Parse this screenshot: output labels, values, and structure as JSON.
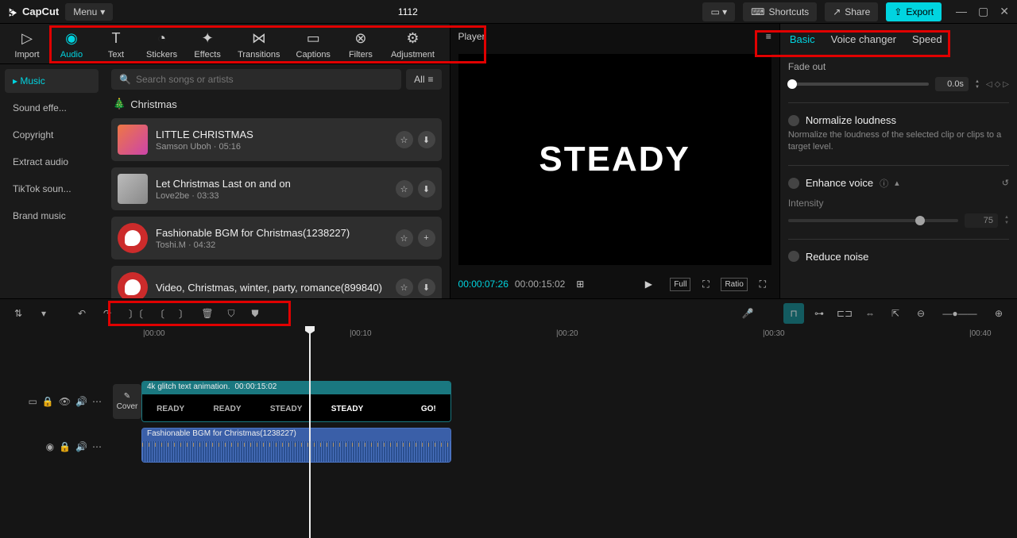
{
  "titlebar": {
    "brand": "CapCut",
    "menu_label": "Menu",
    "project_title": "1112",
    "shortcuts": "Shortcuts",
    "share": "Share",
    "export": "Export"
  },
  "tool_tabs": [
    {
      "id": "import",
      "label": "Import"
    },
    {
      "id": "audio",
      "label": "Audio",
      "active": true
    },
    {
      "id": "text",
      "label": "Text"
    },
    {
      "id": "stickers",
      "label": "Stickers"
    },
    {
      "id": "effects",
      "label": "Effects"
    },
    {
      "id": "transitions",
      "label": "Transitions"
    },
    {
      "id": "captions",
      "label": "Captions"
    },
    {
      "id": "filters",
      "label": "Filters"
    },
    {
      "id": "adjustment",
      "label": "Adjustment"
    }
  ],
  "lib": {
    "categories": [
      {
        "label": "Music",
        "active": true
      },
      {
        "label": "Sound effe..."
      },
      {
        "label": "Copyright"
      },
      {
        "label": "Extract audio"
      },
      {
        "label": "TikTok soun..."
      },
      {
        "label": "Brand music"
      }
    ],
    "search_placeholder": "Search songs or artists",
    "all_label": "All",
    "section": "Christmas",
    "tracks": [
      {
        "title": "LITTLE CHRISTMAS",
        "sub": "Samson Uboh · 05:16",
        "actions": [
          "star",
          "download"
        ]
      },
      {
        "title": "Let Christmas Last on and on",
        "sub": "Love2be · 03:33",
        "actions": [
          "star",
          "download"
        ]
      },
      {
        "title": "Fashionable BGM for Christmas(1238227)",
        "sub": "Toshi.M · 04:32",
        "actions": [
          "star",
          "add"
        ]
      },
      {
        "title": "Video, Christmas, winter, party, romance(899840)",
        "sub": "",
        "actions": [
          "star",
          "download"
        ]
      }
    ]
  },
  "preview": {
    "header_label": "Player",
    "canvas_text": "STEADY",
    "time_current": "00:00:07:26",
    "time_duration": "00:00:15:02",
    "full_label": "Full",
    "ratio_label": "Ratio"
  },
  "inspector": {
    "tabs": [
      {
        "label": "Basic",
        "active": true
      },
      {
        "label": "Voice changer"
      },
      {
        "label": "Speed"
      }
    ],
    "fade_out_label": "Fade out",
    "fade_out_value": "0.0s",
    "normalize_label": "Normalize loudness",
    "normalize_desc": "Normalize the loudness of the selected clip or clips to a target level.",
    "enhance_label": "Enhance voice",
    "intensity_label": "Intensity",
    "intensity_value": "75",
    "reduce_noise_label": "Reduce noise"
  },
  "timeline": {
    "ticks": [
      "|00:00",
      "|00:10",
      "|00:20",
      "|00:30",
      "|00:40"
    ],
    "cover_label": "Cover",
    "video_clip": {
      "title": "4k glitch text animation.",
      "duration": "00:00:15:02",
      "words": [
        "READY",
        "READY",
        "STEADY",
        "STEADY",
        "",
        "GO!"
      ]
    },
    "audio_clip": {
      "title": "Fashionable BGM for Christmas(1238227)"
    }
  }
}
